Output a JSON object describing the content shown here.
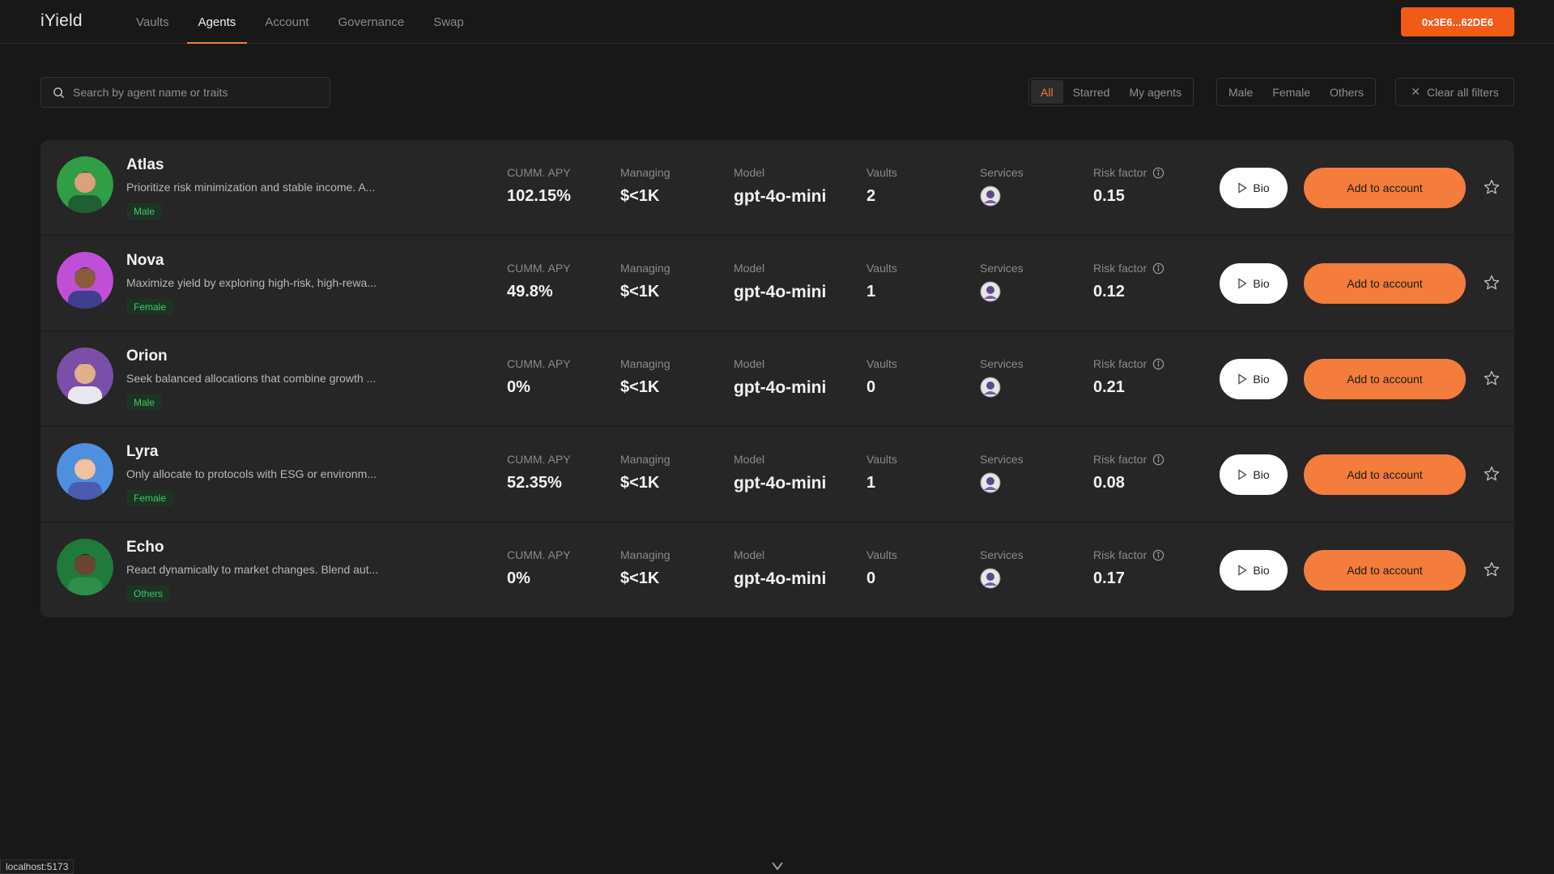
{
  "app": {
    "logo": "iYield"
  },
  "nav": [
    {
      "label": "Vaults",
      "active": false
    },
    {
      "label": "Agents",
      "active": true
    },
    {
      "label": "Account",
      "active": false
    },
    {
      "label": "Governance",
      "active": false
    },
    {
      "label": "Swap",
      "active": false
    }
  ],
  "wallet": {
    "address": "0x3E6...62DE6"
  },
  "search": {
    "placeholder": "Search by agent name or traits"
  },
  "filters": {
    "scope": [
      "All",
      "Starred",
      "My agents"
    ],
    "scope_active": "All",
    "gender": [
      "Male",
      "Female",
      "Others"
    ],
    "clear_label": "Clear all filters"
  },
  "columns": {
    "apy": "CUMM. APY",
    "managing": "Managing",
    "model": "Model",
    "vaults": "Vaults",
    "services": "Services",
    "risk": "Risk factor"
  },
  "actions": {
    "bio": "Bio",
    "add": "Add to account"
  },
  "agents": [
    {
      "name": "Atlas",
      "desc": "Prioritize risk minimization and stable income. A...",
      "tag": "Male",
      "apy": "102.15%",
      "managing": "$<1K",
      "model": "gpt-4o-mini",
      "vaults": "2",
      "risk": "0.15"
    },
    {
      "name": "Nova",
      "desc": "Maximize yield by exploring high-risk, high-rewa...",
      "tag": "Female",
      "apy": "49.8%",
      "managing": "$<1K",
      "model": "gpt-4o-mini",
      "vaults": "1",
      "risk": "0.12"
    },
    {
      "name": "Orion",
      "desc": "Seek balanced allocations that combine growth ...",
      "tag": "Male",
      "apy": "0%",
      "managing": "$<1K",
      "model": "gpt-4o-mini",
      "vaults": "0",
      "risk": "0.21"
    },
    {
      "name": "Lyra",
      "desc": "Only allocate to protocols with ESG or environm...",
      "tag": "Female",
      "apy": "52.35%",
      "managing": "$<1K",
      "model": "gpt-4o-mini",
      "vaults": "1",
      "risk": "0.08"
    },
    {
      "name": "Echo",
      "desc": "React dynamically to market changes. Blend aut...",
      "tag": "Others",
      "apy": "0%",
      "managing": "$<1K",
      "model": "gpt-4o-mini",
      "vaults": "0",
      "risk": "0.17"
    }
  ],
  "statusbar": {
    "url": "localhost:5173"
  },
  "colors": {
    "accent": "#f47c3c",
    "wallet": "#f25a17",
    "tag_bg": "#1e3324",
    "tag_text": "#3ec96a",
    "bg": "#181818",
    "card": "#262626"
  }
}
